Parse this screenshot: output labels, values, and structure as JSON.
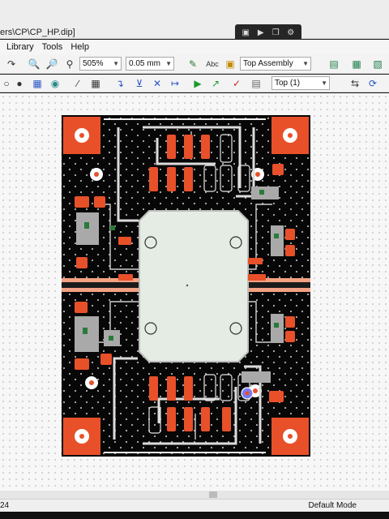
{
  "window": {
    "title": "ers\\CP\\CP_HP.dip]"
  },
  "menu": [
    "Library",
    "Tools",
    "Help"
  ],
  "floating_toolbar": [
    "camera-icon",
    "video-icon",
    "copy-icon",
    "gear-icon"
  ],
  "toolbar1": {
    "zoom_value": "505%",
    "grid_value": "0.05 mm",
    "text_tool_label": "Abc",
    "assembly_select": "Top Assembly"
  },
  "toolbar2": {
    "layer_select": "Top (1)"
  },
  "status": {
    "coordinate": "24",
    "mode": "Default Mode"
  },
  "colors": {
    "board": "#070707",
    "copper_pad": "#e8502a",
    "silkscreen": "#e6e6e6",
    "trace": "#d9d9d9",
    "canvas": "#f7f7f7"
  }
}
